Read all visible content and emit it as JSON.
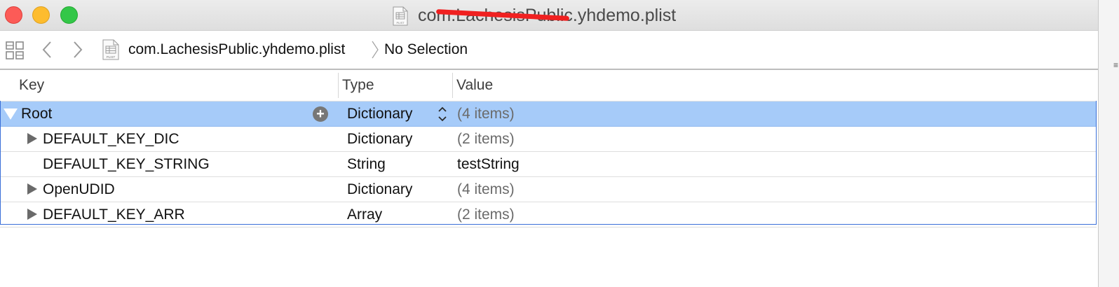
{
  "window": {
    "title": "com.LachesisPublic.yhdemo.plist"
  },
  "toolbar": {
    "breadcrumb_file": "com.LachesisPublic.yhdemo.plist",
    "breadcrumb_selection": "No Selection"
  },
  "columns": {
    "key": "Key",
    "type": "Type",
    "value": "Value"
  },
  "rows": [
    {
      "key": "Root",
      "type": "Dictionary",
      "value": "(4 items)",
      "expanded": true,
      "selected": true
    },
    {
      "key": "DEFAULT_KEY_DIC",
      "type": "Dictionary",
      "value": "(2 items)",
      "expandable": true
    },
    {
      "key": "DEFAULT_KEY_STRING",
      "type": "String",
      "value": "testString"
    },
    {
      "key": "OpenUDID",
      "type": "Dictionary",
      "value": "(4 items)",
      "expandable": true
    },
    {
      "key": "DEFAULT_KEY_ARR",
      "type": "Array",
      "value": "(2 items)",
      "expandable": true
    }
  ],
  "colors": {
    "selection": "#a6cbf9",
    "focus_ring": "#3a6fd8",
    "close": "#fc5b57",
    "minimize": "#fdbc2e",
    "zoom": "#33c748"
  }
}
